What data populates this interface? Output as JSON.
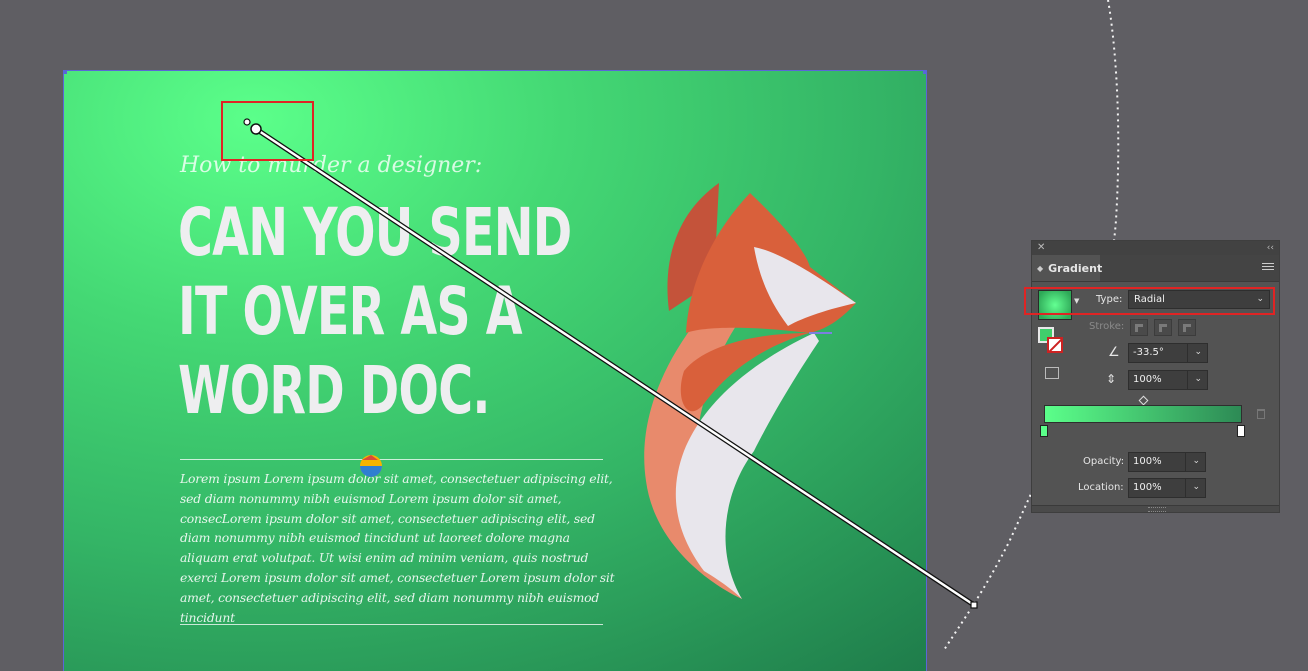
{
  "artboard": {
    "subtitle": "How to murder a designer:",
    "headline": [
      "CAN YOU SEND",
      "IT OVER AS A",
      "WORD DOC."
    ],
    "body_text": "Lorem ipsum Lorem ipsum dolor sit amet, consectetuer adipiscing elit, sed diam nonummy nibh euismod Lorem ipsum dolor sit amet, consecLorem ipsum dolor sit amet, consectetuer adipiscing elit, sed diam nonummy nibh euismod tincidunt ut laoreet dolore magna aliquam erat volutpat. Ut wisi enim ad minim veniam, quis nostrud exerci Lorem ipsum dolor sit amet, consectetuer Lorem ipsum dolor sit amet, consectetuer adipiscing elit, sed diam nonummy nibh euismod tincidunt",
    "gradient_colors": {
      "start": "#5bff8a",
      "end": "#1f7d4b"
    },
    "fox_colors": {
      "dark": "#c4533a",
      "mid": "#d9603b",
      "light": "#e88a6c",
      "white": "#e8e6ec"
    }
  },
  "panel": {
    "title": "Gradient",
    "close_icon": "close-icon",
    "collapse_icon": "double-chevron-left-icon",
    "menu_icon": "hamburger-menu-icon",
    "type_label": "Type:",
    "type_value": "Radial",
    "stroke_label": "Stroke:",
    "angle_value": "-33.5°",
    "aspect_value": "100%",
    "opacity_label": "Opacity:",
    "opacity_value": "100%",
    "location_label": "Location:",
    "location_value": "100%",
    "ramp_colors": {
      "start": "#5bff8a",
      "end": "#2d8a55"
    }
  },
  "highlight_color": "#e02424"
}
